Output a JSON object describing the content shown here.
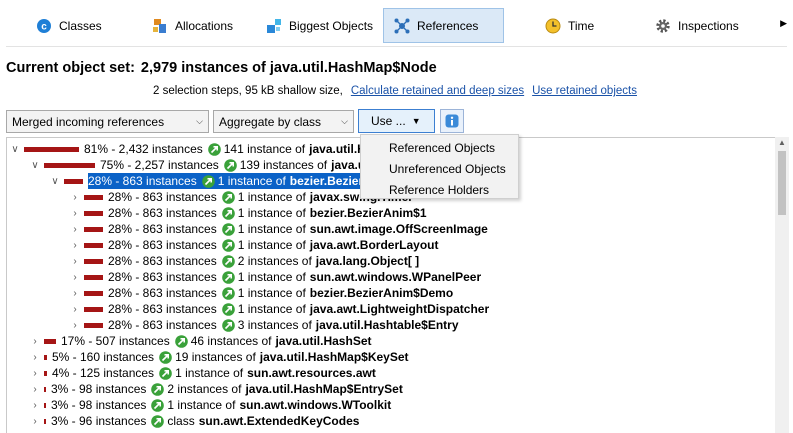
{
  "tabs": [
    {
      "label": "Classes",
      "icon": "classes-icon"
    },
    {
      "label": "Allocations",
      "icon": "allocations-icon"
    },
    {
      "label": "Biggest Objects",
      "icon": "biggest-objects-icon"
    },
    {
      "label": "References",
      "icon": "references-icon",
      "active": true
    },
    {
      "label": "Time",
      "icon": "clock-icon"
    },
    {
      "label": "Inspections",
      "icon": "gear-icon"
    }
  ],
  "header": {
    "label": "Current object set:",
    "value": "2,979 instances of java.util.HashMap$Node",
    "info": "2 selection steps, 95 kB shallow size,",
    "link_calc": "Calculate retained and deep sizes",
    "link_use": "Use retained objects"
  },
  "controls": {
    "view_mode": "Merged incoming references",
    "aggregate": "Aggregate by class",
    "use_button": "Use ..."
  },
  "use_menu": [
    "Referenced Objects",
    "Unreferenced Objects",
    "Reference Holders"
  ],
  "tree": [
    {
      "level": 0,
      "expanded": true,
      "bar_pct": 81,
      "pct_text": "81% - 2,432 instances",
      "count": "141 instance of",
      "cls": "java.util.HashMap$Node"
    },
    {
      "level": 1,
      "expanded": true,
      "bar_pct": 75,
      "pct_text": "75% - 2,257 instances",
      "count": "139 instances of",
      "cls": "java.util.HashMap[ ]"
    },
    {
      "level": 2,
      "expanded": true,
      "selected": true,
      "bar_pct": 28,
      "pct_text": "28% - 863 instances",
      "count": "1 instance of",
      "cls": "bezier.BezierAnim$1"
    },
    {
      "level": 3,
      "expanded": false,
      "bar_pct": 28,
      "pct_text": "28% - 863 instances",
      "count": "1 instance of",
      "cls": "javax.swing.Timer"
    },
    {
      "level": 3,
      "expanded": false,
      "bar_pct": 28,
      "pct_text": "28% - 863 instances",
      "count": "1 instance of",
      "cls": "bezier.BezierAnim$1"
    },
    {
      "level": 3,
      "expanded": false,
      "bar_pct": 28,
      "pct_text": "28% - 863 instances",
      "count": "1 instance of",
      "cls": "sun.awt.image.OffScreenImage"
    },
    {
      "level": 3,
      "expanded": false,
      "bar_pct": 28,
      "pct_text": "28% - 863 instances",
      "count": "1 instance of",
      "cls": "java.awt.BorderLayout"
    },
    {
      "level": 3,
      "expanded": false,
      "bar_pct": 28,
      "pct_text": "28% - 863 instances",
      "count": "2 instances of",
      "cls": "java.lang.Object[ ]"
    },
    {
      "level": 3,
      "expanded": false,
      "bar_pct": 28,
      "pct_text": "28% - 863 instances",
      "count": "1 instance of",
      "cls": "sun.awt.windows.WPanelPeer"
    },
    {
      "level": 3,
      "expanded": false,
      "bar_pct": 28,
      "pct_text": "28% - 863 instances",
      "count": "1 instance of",
      "cls": "bezier.BezierAnim$Demo"
    },
    {
      "level": 3,
      "expanded": false,
      "bar_pct": 28,
      "pct_text": "28% - 863 instances",
      "count": "1 instance of",
      "cls": "java.awt.LightweightDispatcher"
    },
    {
      "level": 3,
      "expanded": false,
      "bar_pct": 28,
      "pct_text": "28% - 863 instances",
      "count": "3 instances of",
      "cls": "java.util.Hashtable$Entry"
    },
    {
      "level": 1,
      "expanded": false,
      "bar_pct": 17,
      "pct_text": "17% - 507 instances",
      "count": "46 instances of",
      "cls": "java.util.HashSet"
    },
    {
      "level": 1,
      "expanded": false,
      "bar_pct": 5,
      "pct_text": "5% - 160 instances",
      "count": "19 instances of",
      "cls": "java.util.HashMap$KeySet"
    },
    {
      "level": 1,
      "expanded": false,
      "bar_pct": 4,
      "pct_text": "4% - 125 instances",
      "count": "1 instance of",
      "cls": "sun.awt.resources.awt"
    },
    {
      "level": 1,
      "expanded": false,
      "bar_pct": 3,
      "pct_text": "3% - 98 instances",
      "count": "2 instances of",
      "cls": "java.util.HashMap$EntrySet"
    },
    {
      "level": 1,
      "expanded": false,
      "bar_pct": 3,
      "pct_text": "3% - 98 instances",
      "count": "1 instance of",
      "cls": "sun.awt.windows.WToolkit"
    },
    {
      "level": 1,
      "expanded": false,
      "bar_pct": 3,
      "pct_text": "3% - 96 instances",
      "count": "class",
      "cls": "sun.awt.ExtendedKeyCodes"
    }
  ],
  "colors": {
    "bar": "#a51515",
    "selection": "#0b62c7",
    "link": "#1a52a8",
    "ref_icon": "#3aa13a"
  }
}
